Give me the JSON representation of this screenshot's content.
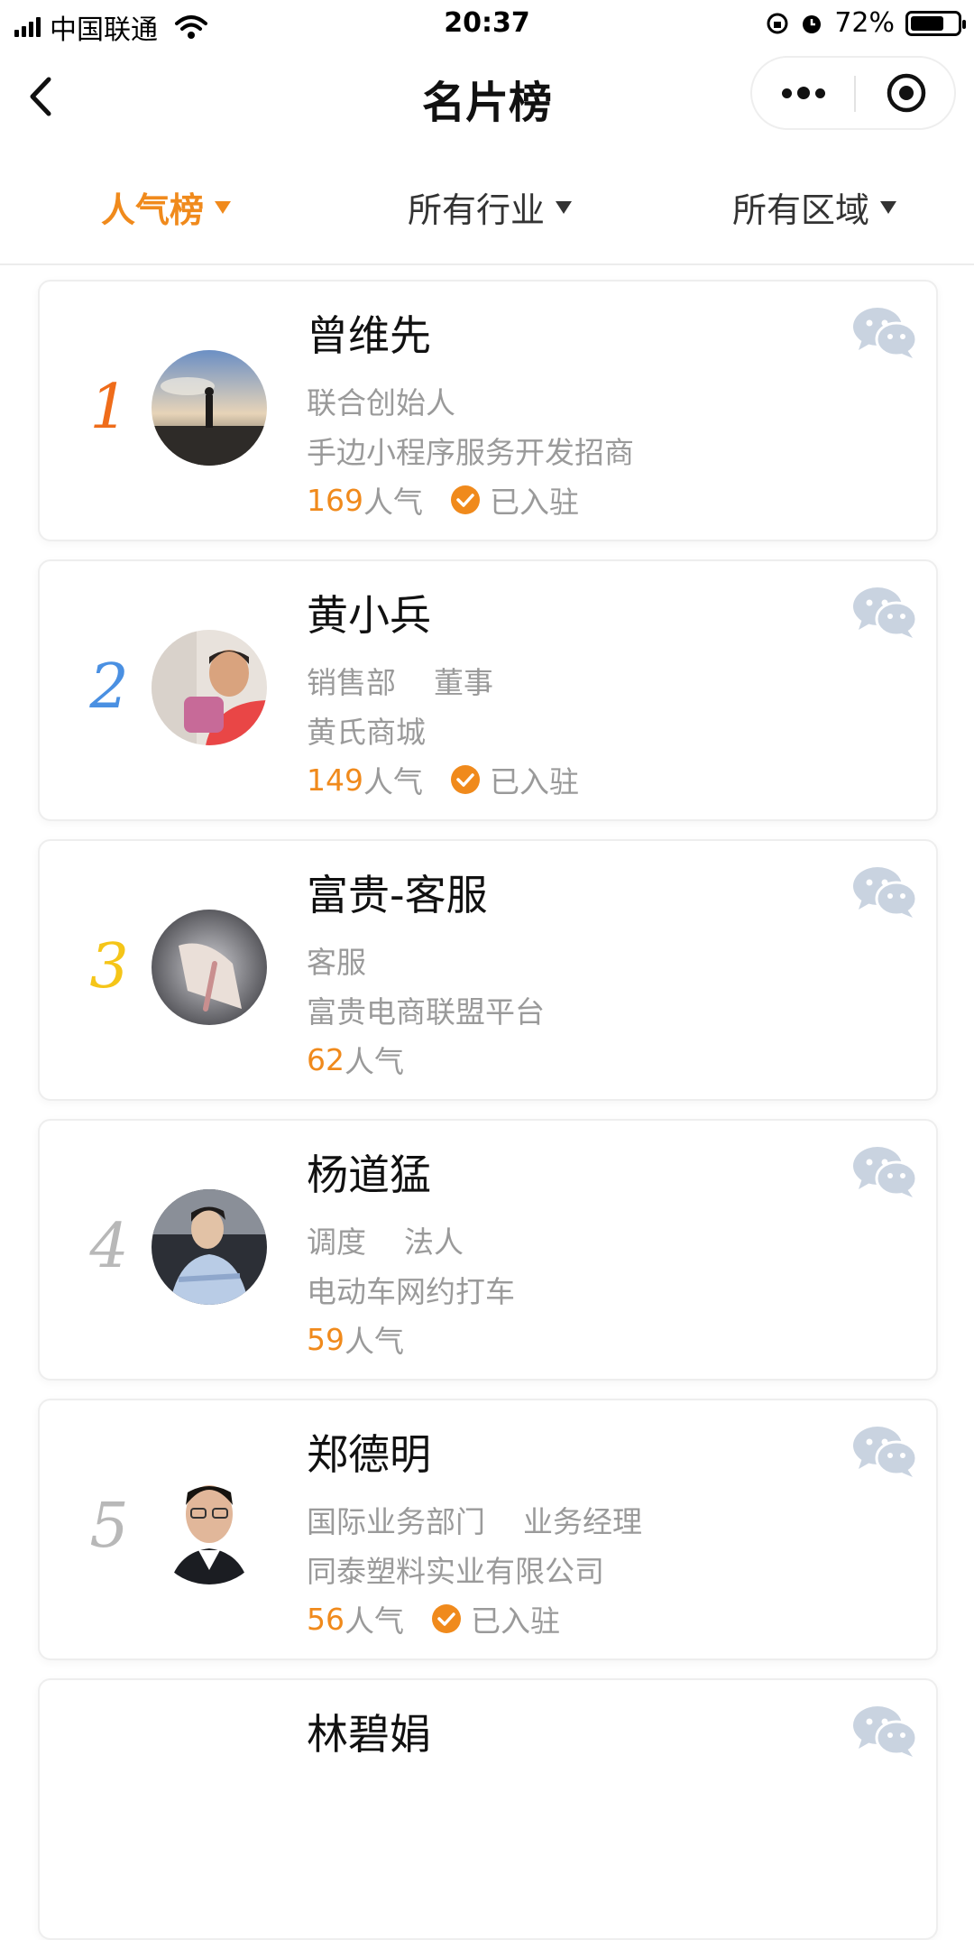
{
  "status_bar": {
    "carrier": "中国联通",
    "time": "20:37",
    "battery": "72%",
    "battery_level": 0.72
  },
  "nav": {
    "title": "名片榜"
  },
  "filters": [
    {
      "label": "人气榜",
      "active": true
    },
    {
      "label": "所有行业",
      "active": false
    },
    {
      "label": "所有区域",
      "active": false
    }
  ],
  "colors": {
    "accent": "#f08a1c",
    "rank1": "#ef6c1a",
    "rank2": "#4a90e2",
    "rank3": "#f5c518",
    "rank_other": "#b8b8b8",
    "wechat_icon": "#c9d3e0",
    "verified_badge": "#f08a1c"
  },
  "cards": [
    {
      "rank": "1",
      "name": "曾维先",
      "line2": "联合创始人",
      "line3": "手边小程序服务开发招商",
      "popularity": "169",
      "popularity_suffix": "人气",
      "verified": "已入驻",
      "avatar": "silhouette-sunset"
    },
    {
      "rank": "2",
      "name": "黄小兵",
      "line2": "销售部    董事",
      "line3": "黄氏商城",
      "popularity": "149",
      "popularity_suffix": "人气",
      "verified": "已入驻",
      "avatar": "man-red-shirt"
    },
    {
      "rank": "3",
      "name": "富贵-客服",
      "line2": "客服",
      "line3": "富贵电商联盟平台",
      "popularity": "62",
      "popularity_suffix": "人气",
      "verified": "",
      "avatar": "hand-on-notebook"
    },
    {
      "rank": "4",
      "name": "杨道猛",
      "line2": "调度    法人",
      "line3": "电动车网约打车",
      "popularity": "59",
      "popularity_suffix": "人气",
      "verified": "",
      "avatar": "young-man-blue-shirt"
    },
    {
      "rank": "5",
      "name": "郑德明",
      "line2": "国际业务部门    业务经理",
      "line3": "同泰塑料实业有限公司",
      "popularity": "56",
      "popularity_suffix": "人气",
      "verified": "已入驻",
      "avatar": "man-with-glasses"
    },
    {
      "rank": "",
      "name": "林碧娟",
      "line2": "",
      "line3": "",
      "popularity": "",
      "popularity_suffix": "",
      "verified": "",
      "avatar": ""
    }
  ]
}
